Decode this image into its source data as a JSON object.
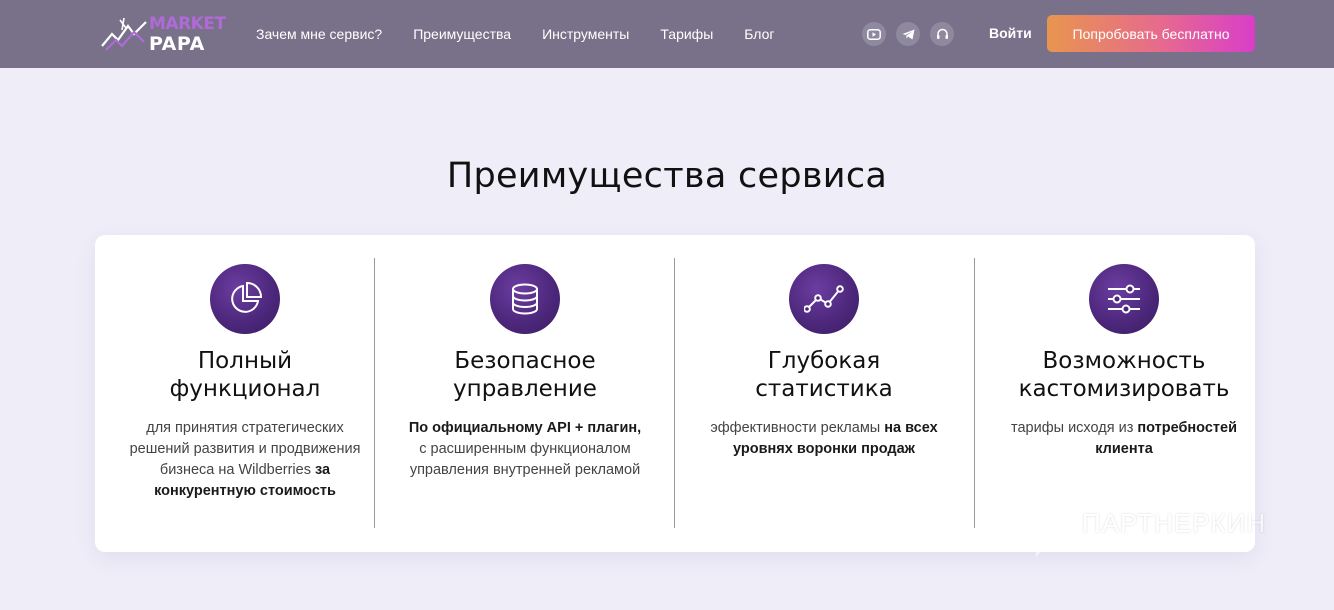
{
  "header": {
    "logo": {
      "line1": "MARKET",
      "line2": "PAPA"
    },
    "nav": [
      "Зачем мне сервис?",
      "Преимущества",
      "Инструменты",
      "Тарифы",
      "Блог"
    ],
    "socials": [
      "youtube-icon",
      "telegram-icon",
      "headset-icon"
    ],
    "login_label": "Войти",
    "cta_label": "Попробовать бесплатно"
  },
  "main": {
    "title": "Преимущества сервиса",
    "features": [
      {
        "icon": "pie-chart-icon",
        "title_1": "Полный",
        "title_2": "функционал",
        "text_plain": "для принятия стратегических решений развития и продвижения бизнеса на Wildberries",
        "text_bold": "за конкурентную стоимость"
      },
      {
        "icon": "database-icon",
        "title_1": "Безопасное",
        "title_2": "управление",
        "text_bold": "По официальному API + плагин,",
        "text_plain": "с расширенным функционалом управления внутренней рекламой"
      },
      {
        "icon": "line-chart-icon",
        "title_1": "Глубокая",
        "title_2": "статистика",
        "text_plain": "эффективности рекламы",
        "text_bold": "на всех уровнях воронки продаж"
      },
      {
        "icon": "sliders-icon",
        "title_1": "Возможность",
        "title_2": "кастомизировать",
        "text_plain": "тарифы исходя из",
        "text_bold": "потребностей клиента"
      }
    ]
  },
  "watermark": {
    "text": "ПАРТНЕРКИН"
  },
  "colors": {
    "header_bg": "#787189",
    "page_bg": "#eeedf8",
    "icon_circle": "#4b2679",
    "cta_gradient_start": "#e8954f",
    "cta_gradient_end": "#d93ec9"
  }
}
